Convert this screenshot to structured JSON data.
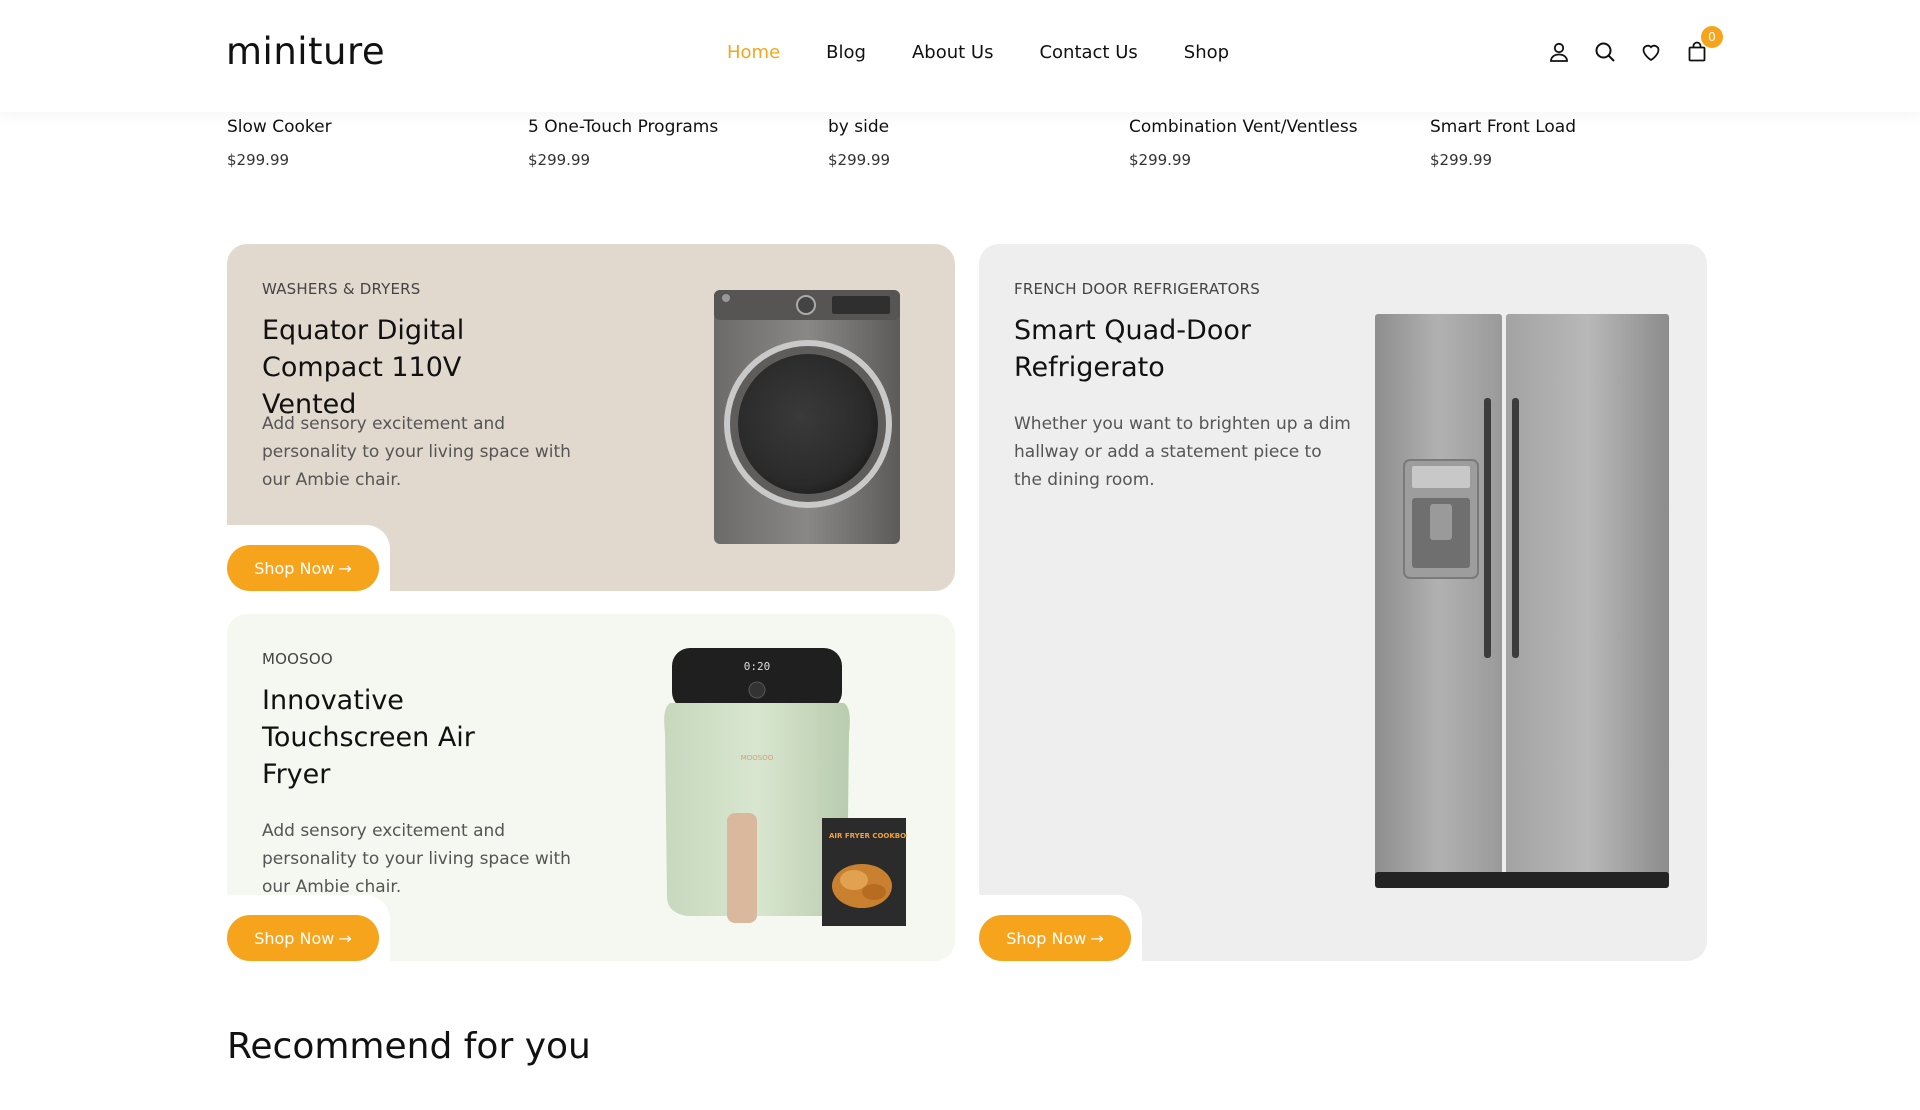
{
  "header": {
    "logo": "miniture",
    "nav": [
      "Home",
      "Blog",
      "About Us",
      "Contact Us",
      "Shop"
    ],
    "active_nav": "Home",
    "cart_count": "0",
    "icons": [
      "user-icon",
      "search-icon",
      "heart-icon",
      "cart-icon"
    ]
  },
  "strip": [
    {
      "name": "Slow Cooker",
      "price": "$299.99"
    },
    {
      "name": "5 One-Touch Programs",
      "price": "$299.99"
    },
    {
      "name": "by side",
      "price": "$299.99"
    },
    {
      "name": "Combination Vent/Ventless",
      "price": "$299.99"
    },
    {
      "name": "Smart Front Load",
      "price": "$299.99"
    }
  ],
  "cards": [
    {
      "category": "WASHERS & DRYERS",
      "title": "Equator Digital Compact 110V Vented",
      "description": "Add sensory excitement and personality to your living space with our Ambie chair.",
      "button": "Shop Now"
    },
    {
      "category": "MOOSOO",
      "title": "Innovative Touchscreen Air Fryer",
      "description": "Add sensory excitement and personality to your living space with our Ambie chair.",
      "button": "Shop Now",
      "fryer_display": "0:20",
      "fryer_brand": "MOOSOO",
      "book_title": "AIR FRYER COOKBOOK"
    },
    {
      "category": "FRENCH DOOR REFRIGERATORS",
      "title": "Smart Quad-Door Refrigerato",
      "description": "Whether you want to brighten up a dim hallway or add a statement piece to the dining room.",
      "button": "Shop Now"
    }
  ],
  "section_title": "Recommend for you",
  "colors": {
    "accent": "#f7a41d",
    "card_beige": "#e2d9ce",
    "card_mint": "#f4f8f0",
    "card_grey": "#eeeeee"
  }
}
